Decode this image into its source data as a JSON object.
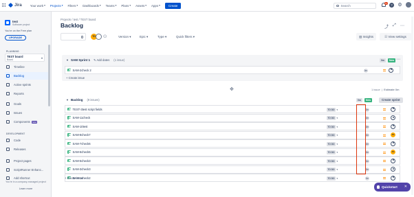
{
  "topnav": {
    "app_name": "Jira",
    "items": [
      {
        "label": "Your work",
        "active": false
      },
      {
        "label": "Projects",
        "active": true
      },
      {
        "label": "Filters",
        "active": false
      },
      {
        "label": "Dashboards",
        "active": false
      },
      {
        "label": "Teams",
        "active": false
      },
      {
        "label": "Plans",
        "active": false
      },
      {
        "label": "Assets",
        "active": false
      },
      {
        "label": "Apps",
        "active": false
      }
    ],
    "create_label": "Create",
    "search_placeholder": "Search",
    "notifications_count": "9+",
    "help_glyph": "?"
  },
  "sidebar": {
    "project_name": "test",
    "project_type": "Software project",
    "plan_note": "You're on the Free plan",
    "upgrade_label": "UPGRADE",
    "planning_label": "PLANNING",
    "board_name": "TEST board",
    "board_type": "Board",
    "planning_items": [
      {
        "label": "Timeline",
        "icon": "timeline-icon"
      },
      {
        "label": "Backlog",
        "icon": "backlog-icon",
        "active": true
      },
      {
        "label": "Active sprints",
        "icon": "board-icon"
      },
      {
        "label": "Reports",
        "icon": "reports-icon"
      }
    ],
    "other_items": [
      {
        "label": "Goals",
        "icon": "goals-icon"
      },
      {
        "label": "Issues",
        "icon": "issues-icon"
      },
      {
        "label": "Components",
        "icon": "components-icon",
        "badge": "NEW"
      }
    ],
    "development_label": "DEVELOPMENT",
    "dev_items": [
      {
        "label": "Code",
        "icon": "code-icon"
      },
      {
        "label": "Releases",
        "icon": "releases-icon"
      }
    ],
    "bottom_items": [
      {
        "label": "Project pages",
        "icon": "pages-icon"
      },
      {
        "label": "ScriptRunner Enhanc...",
        "icon": "scriptrunner-icon"
      },
      {
        "label": "Add shortcut",
        "icon": "add-shortcut-icon"
      }
    ],
    "footer_note": "You're in a company-managed project",
    "learn_more": "Learn more"
  },
  "main": {
    "breadcrumb": "Projects  /  test  /  TEST board",
    "title": "Backlog",
    "filters": [
      "Version",
      "Epic",
      "Type",
      "Quick filters"
    ],
    "avatar_initials": "TD",
    "insights_label": "Insights",
    "settings_label": "View settings"
  },
  "sprint": {
    "name": "SAM Sprint 1",
    "add_dates": "Add dates",
    "issue_count": "(1 issue)",
    "pill_todo": "0m",
    "pill_new": "New",
    "issues": [
      {
        "key": "SAM-2",
        "title": "check 2",
        "status": "",
        "estimate": "0m",
        "assignee": "empty"
      }
    ],
    "create_issue": "+  Create issue"
  },
  "summary": {
    "issue_text": "1 issue",
    "estimate_label": "Estimate",
    "estimate_value": "0m"
  },
  "backlog": {
    "name": "Backlog",
    "issue_count": "(9 issues)",
    "pill_todo": "0m",
    "pill_new": "New",
    "create_sprint": "Create sprint",
    "issues": [
      {
        "key": "TEST-3",
        "title": "test script fields",
        "status": "TO DO",
        "estimate": "0m",
        "assignee": "empty"
      },
      {
        "key": "SAM-11",
        "title": "check",
        "status": "TO DO",
        "estimate": "0m",
        "assignee": "empty"
      },
      {
        "key": "SAM-10",
        "title": "test",
        "status": "TO DO",
        "estimate": "0m",
        "assignee": "empty"
      },
      {
        "key": "SAM-8",
        "title": "check7",
        "status": "TO DO",
        "estimate": "0m",
        "assignee": "TD"
      },
      {
        "key": "SAM-7",
        "title": "check6",
        "status": "TO DO",
        "estimate": "0m",
        "assignee": "empty"
      },
      {
        "key": "SAM-6",
        "title": "check5",
        "status": "TO DO",
        "estimate": "0m",
        "assignee": "TD"
      },
      {
        "key": "SAM-5",
        "title": "check3",
        "status": "TO DO",
        "estimate": "0m",
        "assignee": "empty"
      },
      {
        "key": "SAM-3",
        "title": "check3",
        "status": "TO DO",
        "estimate": "0m",
        "assignee": "empty"
      },
      {
        "key": "SAM-1",
        "title": "check2",
        "status": "TO DO",
        "estimate": "0m",
        "assignee": "empty"
      }
    ],
    "create_issue": "+  Create issue"
  },
  "quickstart": {
    "label": "Quickstart",
    "close": "✕"
  },
  "colors": {
    "accent": "#0052cc",
    "story": "#36b37e",
    "highlight": "#de350b",
    "quickstart": "#5243aa"
  }
}
